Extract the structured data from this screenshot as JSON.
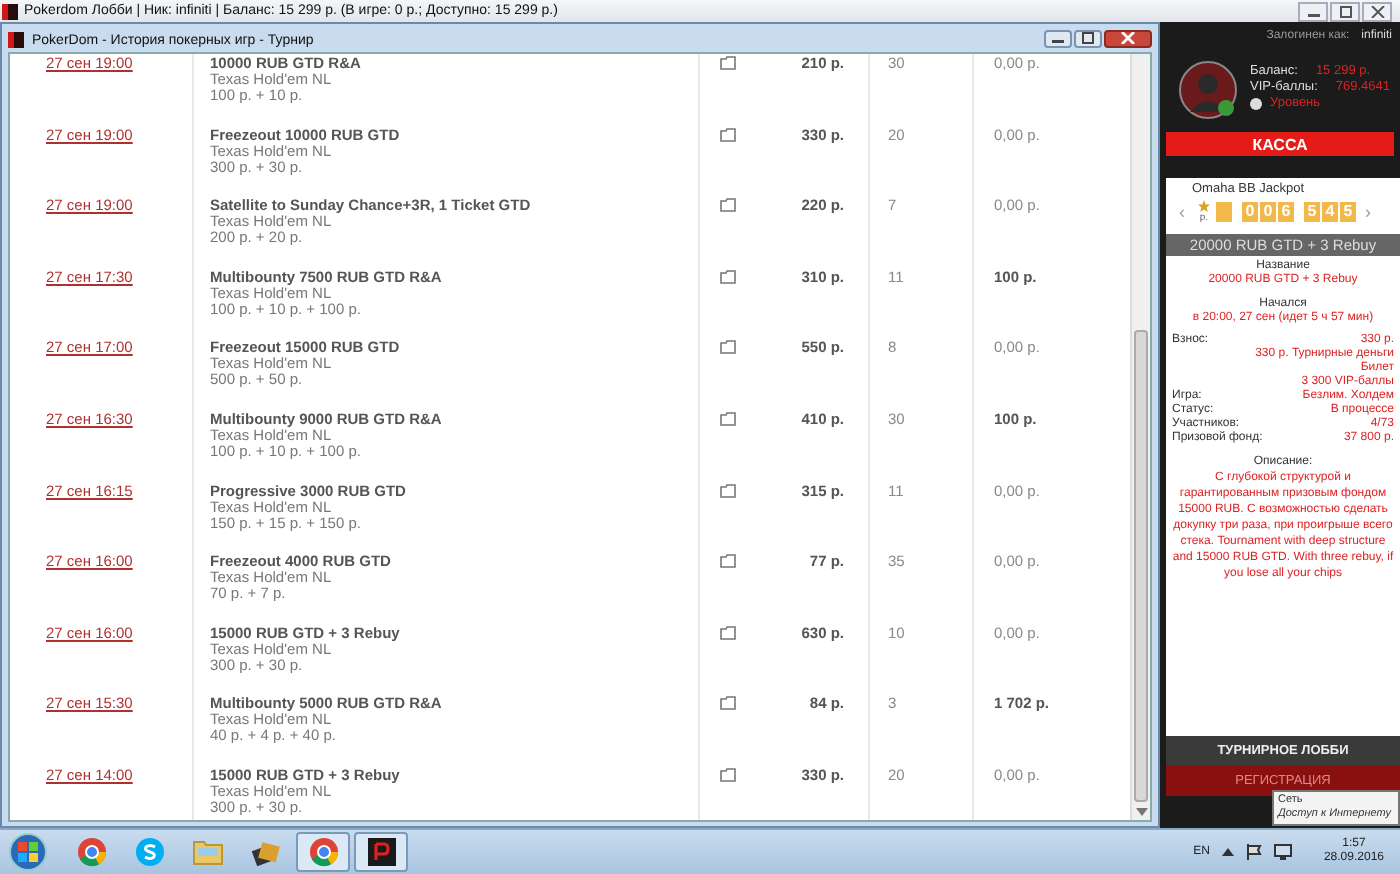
{
  "lobby_window": {
    "title": "Pokerdom Лобби | Ник: infiniti | Баланс: 15 299 р. (В игре: 0 р.; Доступно: 15 299 р.)"
  },
  "history_window": {
    "title": "PokerDom - История покерных игр - Турнир",
    "rows": [
      {
        "date": "27 сен 19:00",
        "name": "10000 RUB GTD R&A",
        "game": "Texas Hold'em NL",
        "buyin": "100 р. + 10 р.",
        "price": "210 р.",
        "players": "30",
        "prize": "0,00 р.",
        "highlighted": false
      },
      {
        "date": "27 сен 19:00",
        "name": "Freezeout 10000 RUB GTD",
        "game": "Texas Hold'em NL",
        "buyin": "300 р. + 30 р.",
        "price": "330 р.",
        "players": "20",
        "prize": "0,00 р.",
        "highlighted": false
      },
      {
        "date": "27 сен 19:00",
        "name": "Satellite to Sunday Chance+3R, 1 Ticket GTD",
        "game": "Texas Hold'em NL",
        "buyin": "200 р. + 20 р.",
        "price": "220 р.",
        "players": "7",
        "prize": "0,00 р.",
        "highlighted": false
      },
      {
        "date": "27 сен 17:30",
        "name": "Multibounty 7500 RUB GTD R&A",
        "game": "Texas Hold'em NL",
        "buyin": "100 р. + 10 р. + 100 р.",
        "price": "310 р.",
        "players": "11",
        "prize": "100 р.",
        "highlighted": true
      },
      {
        "date": "27 сен 17:00",
        "name": "Freezeout 15000 RUB GTD",
        "game": "Texas Hold'em NL",
        "buyin": "500 р. + 50 р.",
        "price": "550 р.",
        "players": "8",
        "prize": "0,00 р.",
        "highlighted": false
      },
      {
        "date": "27 сен 16:30",
        "name": "Multibounty 9000 RUB GTD R&A",
        "game": "Texas Hold'em NL",
        "buyin": "100 р. + 10 р. + 100 р.",
        "price": "410 р.",
        "players": "30",
        "prize": "100 р.",
        "highlighted": true
      },
      {
        "date": "27 сен 16:15",
        "name": "Progressive 3000 RUB GTD",
        "game": "Texas Hold'em NL",
        "buyin": "150 р. + 15 р. + 150 р.",
        "price": "315 р.",
        "players": "11",
        "prize": "0,00 р.",
        "highlighted": false
      },
      {
        "date": "27 сен 16:00",
        "name": "Freezeout 4000 RUB GTD",
        "game": "Texas Hold'em NL",
        "buyin": "70 р. + 7 р.",
        "price": "77 р.",
        "players": "35",
        "prize": "0,00 р.",
        "highlighted": false
      },
      {
        "date": "27 сен 16:00",
        "name": "15000 RUB GTD + 3 Rebuy",
        "game": "Texas Hold'em NL",
        "buyin": "300 р. + 30 р.",
        "price": "630 р.",
        "players": "10",
        "prize": "0,00 р.",
        "highlighted": false
      },
      {
        "date": "27 сен 15:30",
        "name": "Multibounty 5000 RUB GTD R&A",
        "game": "Texas Hold'em NL",
        "buyin": "40 р. + 4 р. + 40 р.",
        "price": "84 р.",
        "players": "3",
        "prize": "1 702 р.",
        "highlighted": true
      },
      {
        "date": "27 сен 14:00",
        "name": "15000 RUB GTD + 3 Rebuy",
        "game": "Texas Hold'em NL",
        "buyin": "300 р. + 30 р.",
        "price": "330 р.",
        "players": "20",
        "prize": "0,00 р.",
        "highlighted": false
      }
    ]
  },
  "lobby_panel": {
    "logged_in_label": "Залогинен как:",
    "nickname": "infiniti",
    "balance_label": "Баланс:",
    "balance": "15 299 р.",
    "vip_label": "VIP-баллы:",
    "vip": "769.4641",
    "level_link": "Уровень",
    "cashier_button": "КАССА",
    "jackpot": {
      "title": "Omaha BB Jackpot",
      "prev": "‹",
      "next": "›",
      "currency": "р.",
      "digits": [
        "0",
        "0",
        "6",
        "5",
        "4",
        "5"
      ]
    },
    "tournament_title": "20000 RUB GTD + 3 Rebuy",
    "name_label": "Название",
    "name": "20000 RUB GTD + 3 Rebuy",
    "started_label": "Начался",
    "started": "в 20:00, 27 сен (идет 5 ч 57 мин)",
    "details": [
      {
        "label": "Взнос:",
        "values": [
          "330 р.",
          "330 р. Турнирные деньги",
          "Билет",
          "3 300 VIP-баллы"
        ]
      },
      {
        "label": "Игра:",
        "values": [
          "Безлим. Холдем"
        ]
      },
      {
        "label": "Статус:",
        "values": [
          "В процессе"
        ]
      },
      {
        "label": "Участников:",
        "values": [
          "4/73"
        ]
      },
      {
        "label": "Призовой фонд:",
        "values": [
          "37 800 р."
        ]
      }
    ],
    "description_label": "Описание:",
    "description": "С глубокой структурой и гарантированным призовым фондом 15000 RUB. С возможностью сделать докупку три раза, при проигрыше всего стека. Tournament with deep structure and 15000 RUB GTD. With three rebuy, if you lose all your chips",
    "lobby_button": "ТУРНИРНОЕ ЛОББИ",
    "register_button": "РЕГИСТРАЦИЯ"
  },
  "tooltip": {
    "title": "Сеть",
    "text": "Доступ к Интернету"
  },
  "taskbar": {
    "apps": [
      {
        "kind": "chrome",
        "selected": false
      },
      {
        "kind": "skype",
        "selected": false
      },
      {
        "kind": "folder",
        "selected": false
      },
      {
        "kind": "app",
        "selected": false
      },
      {
        "kind": "chrome",
        "selected": true
      },
      {
        "kind": "pokerdom",
        "selected": true
      }
    ],
    "language": "EN",
    "time": "1:57",
    "date": "28.09.2016"
  }
}
